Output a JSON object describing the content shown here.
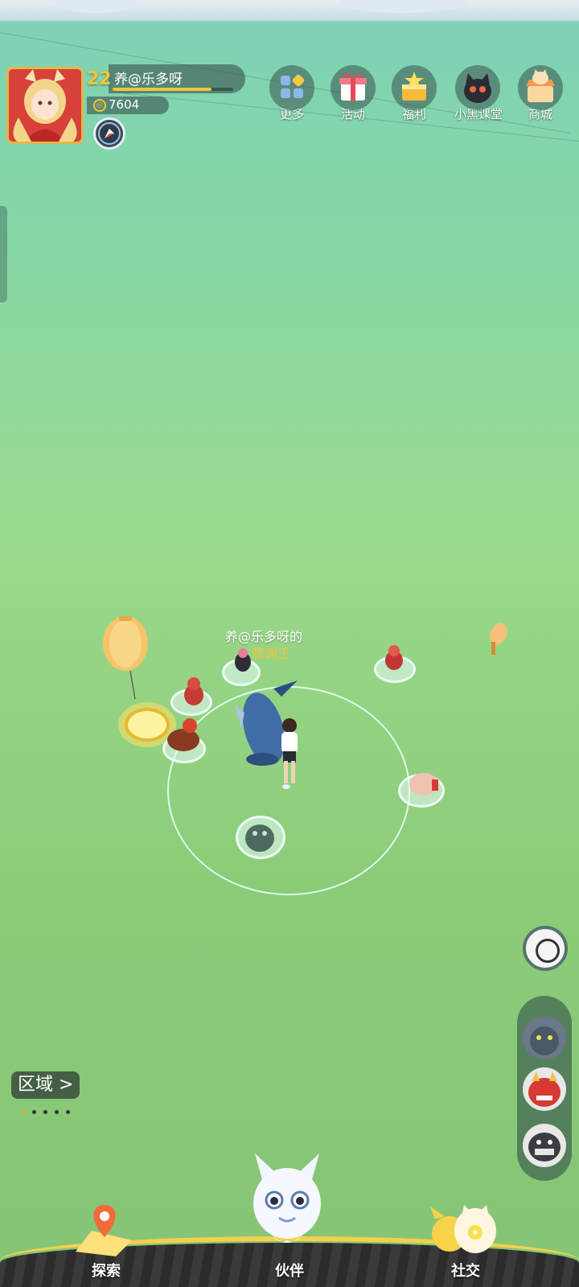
{
  "player": {
    "level": "22",
    "name": "养@乐多呀",
    "coins": "7604",
    "xp_fraction": 0.82
  },
  "top_menu": [
    {
      "label": "更多",
      "icon": "grid-icon"
    },
    {
      "label": "活动",
      "icon": "gift-icon"
    },
    {
      "label": "福利",
      "icon": "treasure-icon"
    },
    {
      "label": "小黑课堂",
      "icon": "black-cat-icon"
    },
    {
      "label": "商城",
      "icon": "shop-icon"
    }
  ],
  "map": {
    "owner_label": "养@乐多呀的",
    "pet_name": "啸渊王",
    "area_button": "区域 >",
    "page_dots": 5,
    "active_dot": 0
  },
  "bottom_nav": [
    {
      "label": "探索",
      "icon": "map-pin-icon"
    },
    {
      "label": "伙伴",
      "icon": "ghost-cat-icon"
    },
    {
      "label": "社交",
      "icon": "friends-icon"
    }
  ],
  "colors": {
    "accent": "#f2c43a",
    "ring": "#e6fffa"
  }
}
